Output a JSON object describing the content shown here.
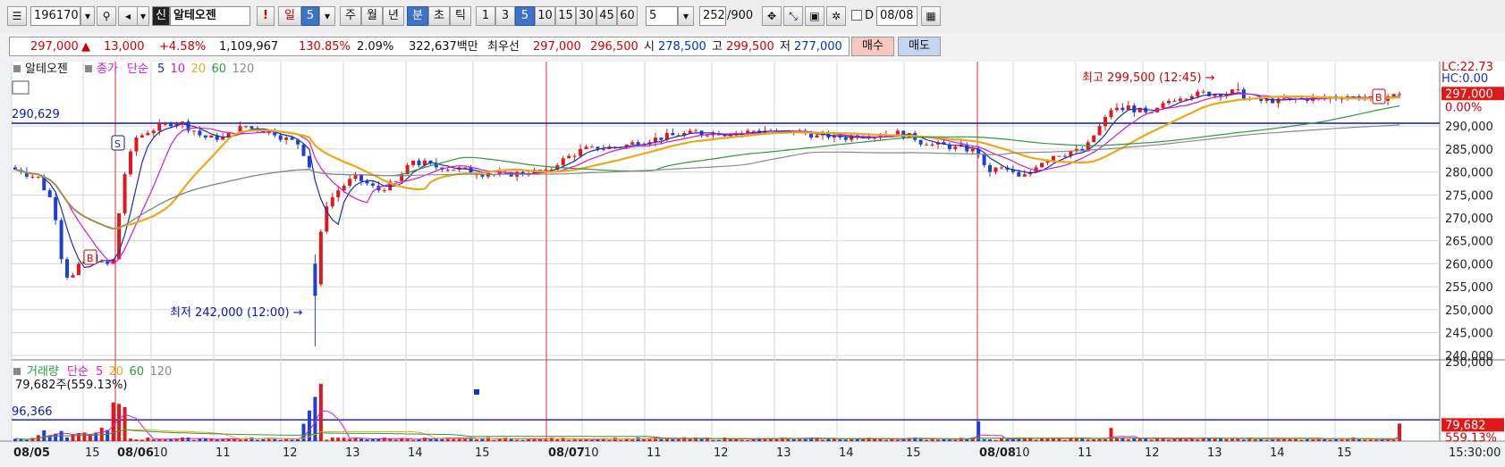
{
  "toolbar": {
    "code": "196170",
    "signal_badge": "신",
    "stock_name": "알테오젠",
    "alert": "!",
    "period_tabs": [
      "일",
      "5",
      "주",
      "월",
      "년",
      "분",
      "초",
      "틱"
    ],
    "minute_tabs": [
      "1",
      "3",
      "5",
      "10",
      "15",
      "30",
      "45",
      "60"
    ],
    "interval": "5",
    "count": "252",
    "count_total": "/900",
    "d_label": "D",
    "date": "08/08"
  },
  "quote": {
    "price": "297,000",
    "arrow": "▲",
    "change": "13,000",
    "change_pct": "+4.58%",
    "volume": "1,109,967",
    "vol_ratio": "130.85%",
    "turnover": "2.09%",
    "amount": "322,637백만",
    "best_label": "최우선",
    "ask": "297,000",
    "bid": "296,500",
    "open_label": "시",
    "open": "278,500",
    "high_label": "고",
    "high": "299,500",
    "low_label": "저",
    "low": "277,000",
    "buy_label": "매수",
    "sell_label": "매도"
  },
  "colors": {
    "up": "#e0181b",
    "down": "#1f3fd1",
    "ma5": "#1a2fb0",
    "ma10": "#d21ad2",
    "ma20": "#e8a91a",
    "ma60": "#2e9a3c",
    "ma120": "#8a8a8a",
    "grid": "#d6d6d6"
  },
  "price_panel": {
    "title_name": "알테오젠",
    "title_ma": [
      "종가",
      "단순",
      "5",
      "10",
      "20",
      "60",
      "120"
    ],
    "hline_label": "290,629",
    "right_labels": {
      "lc": "LC:22.73",
      "hc": "HC:0.00",
      "price": "297,000",
      "pct": "0.00%"
    },
    "annot_high": "최고 299,500 (12:45) →",
    "annot_low": "최저 242,000 (12:00) →",
    "marker_s": "S",
    "marker_b": "B"
  },
  "volume_panel": {
    "title": [
      "거래량",
      "단순",
      "5",
      "20",
      "60",
      "120"
    ],
    "current": "79,682주(559.13%)",
    "hline_label": "96,366",
    "right_labels": {
      "vol": "79,682",
      "pct": "559.13%",
      "axis": "250,000"
    }
  },
  "x_axis": {
    "labels": [
      "08/05",
      "15",
      "08/06",
      "10",
      "11",
      "12",
      "13",
      "14",
      "15",
      "08/07",
      "10",
      "11",
      "12",
      "13",
      "14",
      "15",
      "08/08",
      "10",
      "11",
      "12",
      "13",
      "14",
      "15"
    ],
    "time_label": "15:30:00"
  },
  "chart_data": {
    "type": "candlestick",
    "y_axis_ticks": [
      "290,000",
      "285,000",
      "280,000",
      "275,000",
      "270,000",
      "265,000",
      "260,000",
      "255,000",
      "250,000",
      "245,000",
      "240,000"
    ],
    "ylim": [
      237500,
      302500
    ],
    "high": {
      "value": 299500,
      "time": "12:45"
    },
    "low": {
      "value": 242000,
      "time": "12:00"
    },
    "reference_line": 290629,
    "last_close": 297000,
    "volume_reference": 96366,
    "last_volume": 79682,
    "volume_axis_tick": 250000
  }
}
